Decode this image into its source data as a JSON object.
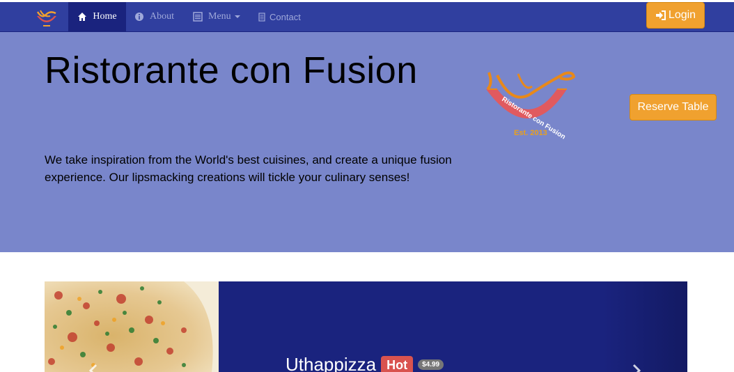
{
  "navbar": {
    "brand": "Ristorante con Fusion logo",
    "items": [
      {
        "label": "Home",
        "icon": "home-icon",
        "active": true
      },
      {
        "label": "About",
        "icon": "info-sign-icon",
        "active": false
      },
      {
        "label": "Menu",
        "icon": "list-alt-icon",
        "active": false,
        "dropdown": true
      },
      {
        "label": "Contact",
        "icon": "envelope-icon",
        "active": false
      }
    ],
    "login_label": "Login",
    "login_icon": "log-in-icon"
  },
  "hero": {
    "title": "Ristorante con Fusion",
    "text": "We take inspiration from the World's best cuisines, and create a unique fusion experience. Our lipsmacking creations will tickle your culinary senses!",
    "logo_text": "Ristorante con Fusion",
    "logo_year": "Est. 2013",
    "reserve_label": "Reserve Table"
  },
  "carousel": {
    "dish_name": "Uthappizza",
    "hot_badge": "Hot",
    "price_badge": "$4.99"
  },
  "colors": {
    "navbar": "#303f9f",
    "navbar_active": "#1a237e",
    "jumbotron": "#7986cb",
    "accent": "#f0a12f",
    "carousel": "#1a237e",
    "hot": "#d9534f",
    "price": "#777777"
  }
}
